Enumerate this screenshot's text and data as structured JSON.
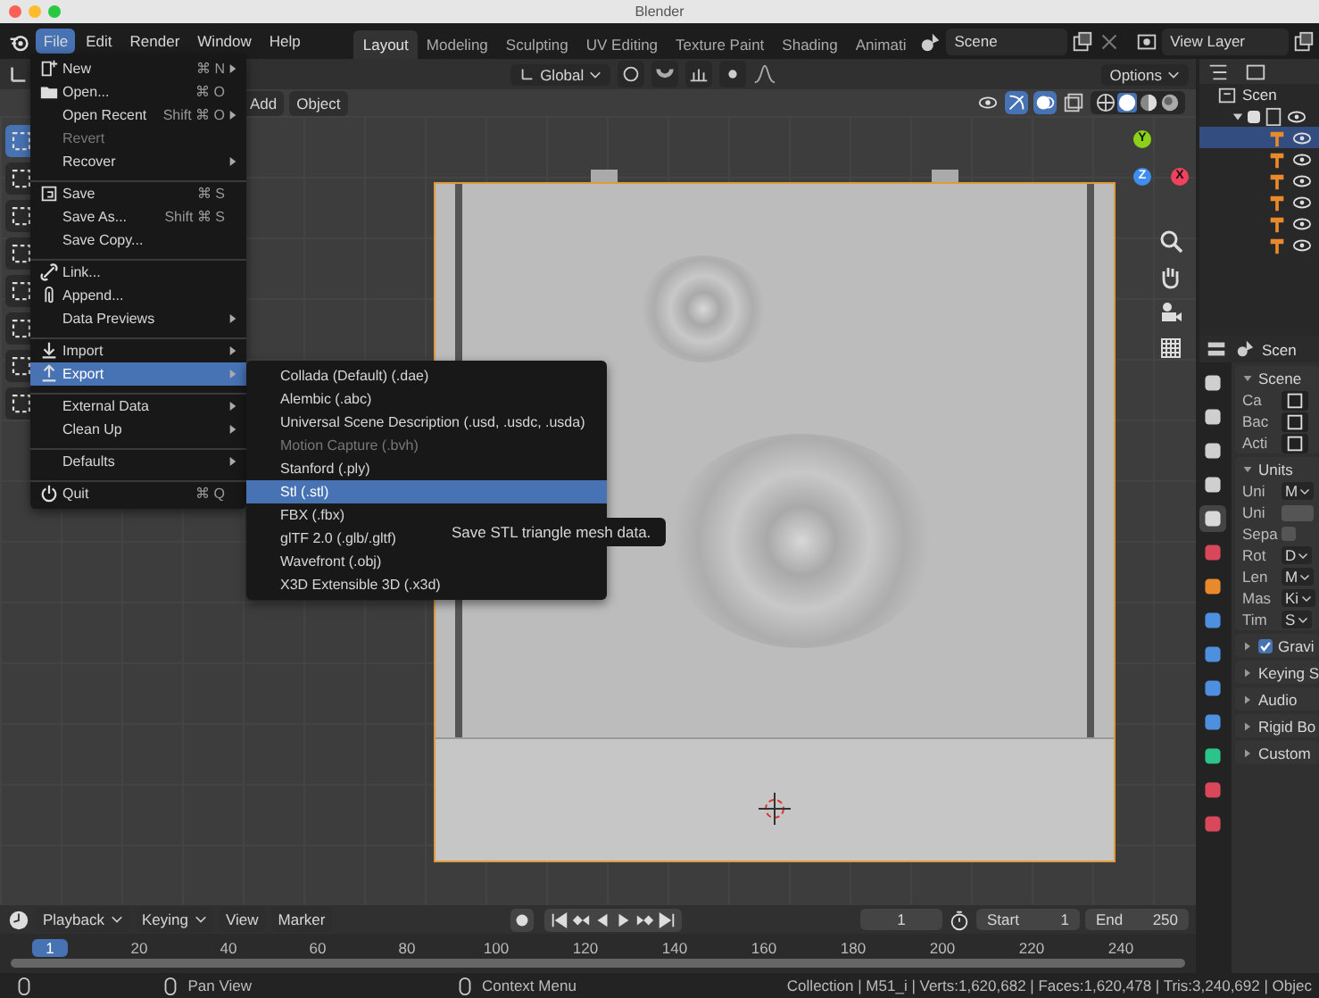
{
  "window": {
    "title": "Blender"
  },
  "menubar": [
    {
      "label": "File",
      "selected": true
    },
    {
      "label": "Edit",
      "selected": false
    },
    {
      "label": "Render",
      "selected": false
    },
    {
      "label": "Window",
      "selected": false
    },
    {
      "label": "Help",
      "selected": false
    }
  ],
  "workspaces": [
    {
      "label": "Layout",
      "selected": true
    },
    {
      "label": "Modeling",
      "selected": false
    },
    {
      "label": "Sculpting",
      "selected": false
    },
    {
      "label": "UV Editing",
      "selected": false
    },
    {
      "label": "Texture Paint",
      "selected": false
    },
    {
      "label": "Shading",
      "selected": false
    },
    {
      "label": "Animati",
      "selected": false
    }
  ],
  "scene_field": {
    "value": "Scene"
  },
  "view_layer_field": {
    "value": "View Layer"
  },
  "viewport": {
    "orientation": "Global",
    "options": "Options",
    "menus": [
      "Add",
      "Object"
    ],
    "gizmo": {
      "x": "X",
      "y": "Y",
      "z": "Z"
    }
  },
  "file_menu": [
    {
      "label": "New",
      "shortcut": "⌘ N",
      "submenu": true,
      "disabled": false,
      "separator_before": false
    },
    {
      "label": "Open...",
      "shortcut": "⌘ O",
      "submenu": false,
      "disabled": false,
      "separator_before": false
    },
    {
      "label": "Open Recent",
      "shortcut": "Shift ⌘ O",
      "submenu": true,
      "disabled": false,
      "separator_before": false
    },
    {
      "label": "Revert",
      "submenu": false,
      "disabled": true,
      "separator_before": false
    },
    {
      "label": "Recover",
      "submenu": true,
      "disabled": false,
      "separator_before": false
    },
    {
      "label": "Save",
      "shortcut": "⌘ S",
      "submenu": false,
      "disabled": false,
      "separator_before": true
    },
    {
      "label": "Save As...",
      "shortcut": "Shift ⌘ S",
      "submenu": false,
      "disabled": false,
      "separator_before": false
    },
    {
      "label": "Save Copy...",
      "submenu": false,
      "disabled": false,
      "separator_before": false
    },
    {
      "label": "Link...",
      "submenu": false,
      "disabled": false,
      "separator_before": true
    },
    {
      "label": "Append...",
      "submenu": false,
      "disabled": false,
      "separator_before": false
    },
    {
      "label": "Data Previews",
      "submenu": true,
      "disabled": false,
      "separator_before": false
    },
    {
      "label": "Import",
      "submenu": true,
      "disabled": false,
      "separator_before": true
    },
    {
      "label": "Export",
      "submenu": true,
      "disabled": false,
      "separator_before": false,
      "selected": true
    },
    {
      "label": "External Data",
      "submenu": true,
      "disabled": false,
      "separator_before": true
    },
    {
      "label": "Clean Up",
      "submenu": true,
      "disabled": false,
      "separator_before": false
    },
    {
      "label": "Defaults",
      "submenu": true,
      "disabled": false,
      "separator_before": true
    },
    {
      "label": "Quit",
      "shortcut": "⌘ Q",
      "submenu": false,
      "disabled": false,
      "separator_before": true
    }
  ],
  "export_menu": [
    {
      "label": "Collada (Default) (.dae)",
      "disabled": false,
      "selected": false
    },
    {
      "label": "Alembic (.abc)",
      "disabled": false,
      "selected": false
    },
    {
      "label": "Universal Scene Description (.usd, .usdc, .usda)",
      "disabled": false,
      "selected": false
    },
    {
      "label": "Motion Capture (.bvh)",
      "disabled": true,
      "selected": false
    },
    {
      "label": "Stanford (.ply)",
      "disabled": false,
      "selected": false
    },
    {
      "label": "Stl (.stl)",
      "disabled": false,
      "selected": true
    },
    {
      "label": "FBX (.fbx)",
      "disabled": false,
      "selected": false
    },
    {
      "label": "glTF 2.0 (.glb/.gltf)",
      "disabled": false,
      "selected": false
    },
    {
      "label": "Wavefront (.obj)",
      "disabled": false,
      "selected": false
    },
    {
      "label": "X3D Extensible 3D (.x3d)",
      "disabled": false,
      "selected": false
    }
  ],
  "tooltip": "Save STL triangle mesh data.",
  "outliner": {
    "title": "Scen",
    "collection": {
      "expanded": true,
      "checked": true,
      "children": [
        {
          "selected": true
        },
        {
          "selected": false
        },
        {
          "selected": false
        },
        {
          "selected": false
        },
        {
          "selected": false
        },
        {
          "selected": false
        }
      ]
    }
  },
  "properties": {
    "title": "Scen",
    "tabs": [
      {
        "selected": false,
        "color": "#cfcfcf"
      },
      {
        "selected": false,
        "color": "#cfcfcf"
      },
      {
        "selected": false,
        "color": "#cfcfcf"
      },
      {
        "selected": false,
        "color": "#cfcfcf"
      },
      {
        "selected": true,
        "color": "#d8d8d8"
      },
      {
        "selected": false,
        "color": "#d9485a"
      },
      {
        "selected": false,
        "color": "#e8892c"
      },
      {
        "selected": false,
        "color": "#4f8fe0"
      },
      {
        "selected": false,
        "color": "#4f8fe0"
      },
      {
        "selected": false,
        "color": "#4f8fe0"
      },
      {
        "selected": false,
        "color": "#4f8fe0"
      },
      {
        "selected": false,
        "color": "#2bc48a"
      },
      {
        "selected": false,
        "color": "#d9485a"
      },
      {
        "selected": false,
        "color": "#d9485a"
      }
    ],
    "panels": [
      {
        "title": "Scene",
        "expanded": true,
        "rows": [
          {
            "label": "Ca",
            "kind": "picker"
          },
          {
            "label": "Bac",
            "kind": "picker"
          },
          {
            "label": "Acti",
            "kind": "picker"
          }
        ]
      },
      {
        "title": "Units",
        "expanded": true,
        "rows": [
          {
            "label": "Uni",
            "kind": "dropdown",
            "value": "M"
          },
          {
            "label": "Uni",
            "kind": "field"
          },
          {
            "label": "Sepa",
            "kind": "checkbox",
            "checked": false
          },
          {
            "label": "Rot",
            "kind": "dropdown",
            "value": "D"
          },
          {
            "label": "Len",
            "kind": "dropdown",
            "value": "M"
          },
          {
            "label": "Mas",
            "kind": "dropdown",
            "value": "Ki"
          },
          {
            "label": "Tim",
            "kind": "dropdown",
            "value": "S"
          }
        ]
      },
      {
        "title": "Gravi",
        "expanded": false,
        "kind": "toggle",
        "checked": true
      },
      {
        "title": "Keying S",
        "expanded": false,
        "kind": "plain"
      },
      {
        "title": "Audio",
        "expanded": false,
        "kind": "plain"
      },
      {
        "title": "Rigid Bo",
        "expanded": false,
        "kind": "plain"
      },
      {
        "title": "Custom",
        "expanded": false,
        "kind": "plain"
      }
    ]
  },
  "timeline": {
    "menus": [
      "Playback",
      "Keying",
      "View",
      "Marker"
    ],
    "current_frame": "1",
    "start_label": "Start",
    "start": "1",
    "end_label": "End",
    "end": "250",
    "ruler": [
      {
        "label": "1",
        "selected": true
      },
      {
        "label": "20",
        "selected": false
      },
      {
        "label": "40",
        "selected": false
      },
      {
        "label": "60",
        "selected": false
      },
      {
        "label": "80",
        "selected": false
      },
      {
        "label": "100",
        "selected": false
      },
      {
        "label": "120",
        "selected": false
      },
      {
        "label": "140",
        "selected": false
      },
      {
        "label": "160",
        "selected": false
      },
      {
        "label": "180",
        "selected": false
      },
      {
        "label": "200",
        "selected": false
      },
      {
        "label": "220",
        "selected": false
      },
      {
        "label": "240",
        "selected": false
      }
    ]
  },
  "status_bar": {
    "hints": [
      "Pan View",
      "Context Menu"
    ],
    "stats": "Collection | M51_i | Verts:1,620,682 | Faces:1,620,478 | Tris:3,240,692 | Objec"
  }
}
